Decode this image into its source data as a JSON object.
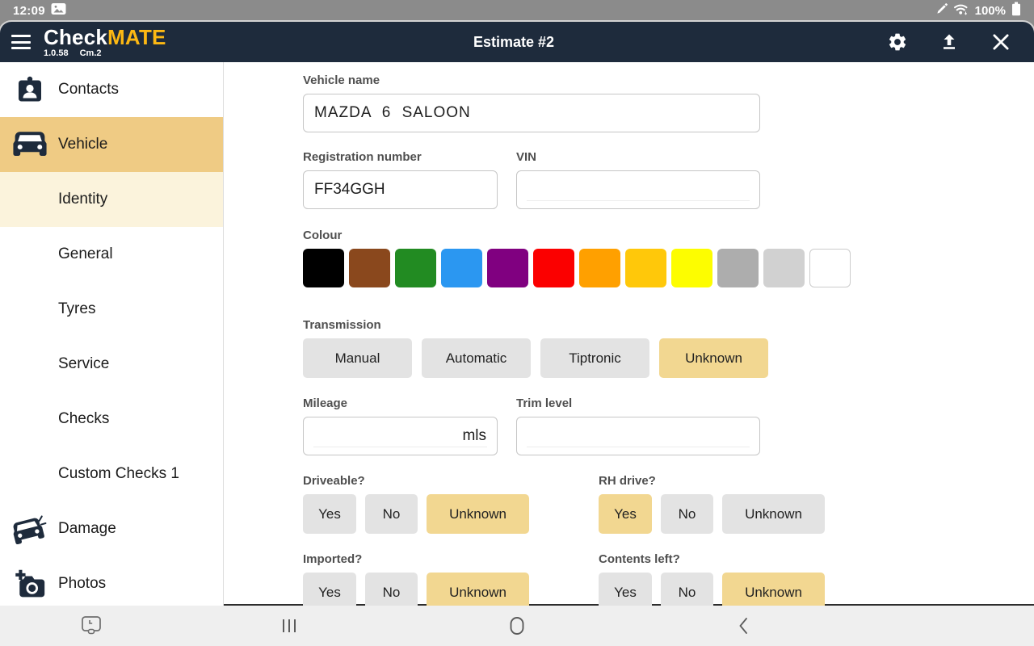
{
  "status_bar": {
    "time": "12:09",
    "battery_percent": "100%",
    "icons": [
      "image-thumbnail-icon",
      "pen-icon",
      "wifi-icon",
      "battery-icon"
    ]
  },
  "header": {
    "logo": {
      "part1": "Check",
      "part2": "MATE",
      "version": "1.0.58",
      "build": "Cm.2"
    },
    "title": "Estimate #2",
    "icons": [
      "menu-icon",
      "settings-gear-icon",
      "upload-icon",
      "close-icon"
    ]
  },
  "sidebar": {
    "items": [
      {
        "label": "Contacts",
        "icon": "contact-card-icon",
        "level": "top",
        "state": "normal"
      },
      {
        "label": "Vehicle",
        "icon": "car-icon",
        "level": "top",
        "state": "selected"
      },
      {
        "label": "Identity",
        "icon": null,
        "level": "sub",
        "state": "selected-sub"
      },
      {
        "label": "General",
        "icon": null,
        "level": "sub",
        "state": "normal"
      },
      {
        "label": "Tyres",
        "icon": null,
        "level": "sub",
        "state": "normal"
      },
      {
        "label": "Service",
        "icon": null,
        "level": "sub",
        "state": "normal"
      },
      {
        "label": "Checks",
        "icon": null,
        "level": "sub",
        "state": "normal"
      },
      {
        "label": "Custom Checks 1",
        "icon": null,
        "level": "sub",
        "state": "normal"
      },
      {
        "label": "Damage",
        "icon": "damaged-car-icon",
        "level": "top",
        "state": "normal"
      },
      {
        "label": "Photos",
        "icon": "camera-plus-icon",
        "level": "top",
        "state": "normal"
      }
    ]
  },
  "form": {
    "vehicle_name": {
      "label": "Vehicle name",
      "value": "MAZDA 6 SALOON"
    },
    "registration": {
      "label": "Registration number",
      "value": "FF34GGH"
    },
    "vin": {
      "label": "VIN",
      "value": ""
    },
    "colour": {
      "label": "Colour",
      "swatches": [
        {
          "name": "black",
          "hex": "#000000"
        },
        {
          "name": "brown",
          "hex": "#8a481d"
        },
        {
          "name": "green",
          "hex": "#228b22"
        },
        {
          "name": "blue",
          "hex": "#2b97f1"
        },
        {
          "name": "purple",
          "hex": "#800080"
        },
        {
          "name": "red",
          "hex": "#fb0000"
        },
        {
          "name": "orange",
          "hex": "#ffa000"
        },
        {
          "name": "gold",
          "hex": "#ffc80a"
        },
        {
          "name": "yellow",
          "hex": "#fdfd00"
        },
        {
          "name": "gray",
          "hex": "#adadad"
        },
        {
          "name": "light-gray",
          "hex": "#d1d1d1"
        },
        {
          "name": "white",
          "hex": "#ffffff"
        }
      ]
    },
    "transmission": {
      "label": "Transmission",
      "options": [
        "Manual",
        "Automatic",
        "Tiptronic",
        "Unknown"
      ],
      "selected": "Unknown"
    },
    "mileage": {
      "label": "Mileage",
      "value": "",
      "suffix": "mls"
    },
    "trim_level": {
      "label": "Trim level",
      "value": ""
    },
    "driveable": {
      "label": "Driveable?",
      "options": [
        "Yes",
        "No",
        "Unknown"
      ],
      "selected": "Unknown"
    },
    "rh_drive": {
      "label": "RH drive?",
      "options": [
        "Yes",
        "No",
        "Unknown"
      ],
      "selected": "Yes"
    },
    "imported": {
      "label": "Imported?",
      "options": [
        "Yes",
        "No",
        "Unknown"
      ],
      "selected": "Unknown"
    },
    "contents_left": {
      "label": "Contents left?",
      "options": [
        "Yes",
        "No",
        "Unknown"
      ],
      "selected": "Unknown"
    }
  },
  "nav_bar": {
    "icons": [
      "screen-capture-icon",
      "recents-icon",
      "home-icon",
      "back-icon"
    ]
  },
  "colors": {
    "header_navy": "#1e2b3c",
    "logo_gold": "#fcb813",
    "selected_row": "#efcb84",
    "selected_sub_row": "#fbf3dc",
    "selected_button": "#f2d791",
    "button_gray": "#e3e3e3",
    "status_bar_gray": "#8b8b8b",
    "nav_bar_gray": "#efefef"
  }
}
